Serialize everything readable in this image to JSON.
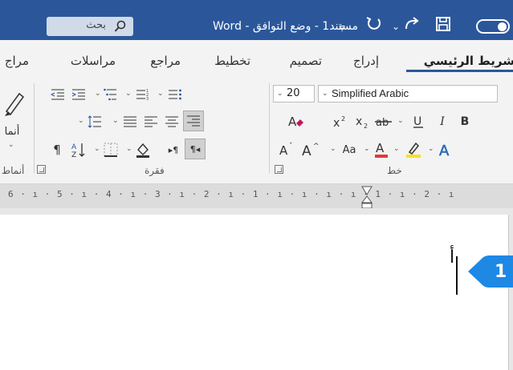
{
  "titlebar": {
    "title": "مستند1 - وضع التوافق - Word",
    "search_label": "بحث",
    "icons": [
      "toggle-icon",
      "save-icon",
      "redo-icon",
      "undo-icon",
      "customize-icon",
      "search-icon"
    ]
  },
  "tabs": [
    {
      "label": "شريط الرئيسي",
      "active": true
    },
    {
      "label": "إدراج"
    },
    {
      "label": "تصميم"
    },
    {
      "label": "تخطيط"
    },
    {
      "label": "مراجع"
    },
    {
      "label": "مراسلات"
    },
    {
      "label": "مراج"
    }
  ],
  "font_group": {
    "label": "خط",
    "font_name": "Simplified Arabic",
    "font_size": "20"
  },
  "paragraph_group": {
    "label": "فقرة"
  },
  "styles_group": {
    "label": "أنماط",
    "button_label": "أنما"
  },
  "ruler": {
    "text": "6 · ı · 5 · ı · 4 · ı · 3 · ı · 2 · ı · 1 · ı · ı · ı · ı · 1 · ı · 2 · ı"
  },
  "document": {
    "typed_text": "أ"
  },
  "callout": {
    "number": "1",
    "color": "#1e88e5"
  },
  "colors": {
    "titlebar": "#2b579a",
    "ribbon": "#f3f3f3",
    "accent_underline": "#2b579a",
    "font_color_bar": "#e53935",
    "highlight_bar": "#f9e11e",
    "text_effects_blue": "#2b7bd6"
  }
}
